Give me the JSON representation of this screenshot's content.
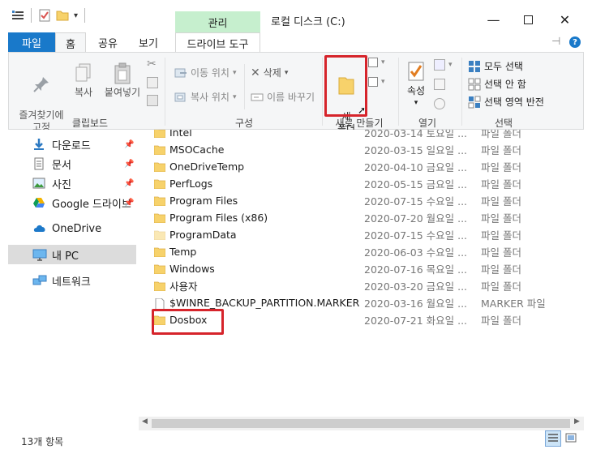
{
  "window": {
    "title": "로컬 디스크 (C:)",
    "context_tab": "관리"
  },
  "tabs": {
    "file": "파일",
    "home": "홈",
    "share": "공유",
    "view": "보기",
    "drive_tools": "드라이브 도구"
  },
  "ribbon": {
    "pin": "즐겨찾기에\n고정",
    "copy": "복사",
    "paste": "붙여넣기",
    "clipboard_group": "클립보드",
    "move_to": "이동 위치",
    "copy_to": "복사 위치",
    "delete": "삭제",
    "rename": "이름 바꾸기",
    "organize_group": "구성",
    "new_folder": "새\n폴더",
    "new_group": "새로 만들기",
    "properties": "속성",
    "open_group": "열기",
    "select_all": "모두 선택",
    "select_none": "선택 안 함",
    "invert_selection": "선택 영역 반전",
    "select_group": "선택"
  },
  "nav": [
    {
      "label": "다운로드",
      "icon": "download-icon",
      "pinned": true,
      "selected": false
    },
    {
      "label": "문서",
      "icon": "documents-icon",
      "pinned": true,
      "selected": false
    },
    {
      "label": "사진",
      "icon": "pictures-icon",
      "pinned": true,
      "selected": false
    },
    {
      "label": "Google 드라이브",
      "icon": "google-drive-icon",
      "pinned": true,
      "selected": false
    },
    {
      "label": "OneDrive",
      "icon": "onedrive-icon",
      "pinned": false,
      "selected": false
    },
    {
      "label": "내 PC",
      "icon": "this-pc-icon",
      "pinned": false,
      "selected": true
    },
    {
      "label": "네트워크",
      "icon": "network-icon",
      "pinned": false,
      "selected": false
    }
  ],
  "files": [
    {
      "name": "Intel",
      "date": "2020-03-14 토요일 ...",
      "type": "파일 폴더",
      "kind": "folder"
    },
    {
      "name": "MSOCache",
      "date": "2020-03-15 일요일 ...",
      "type": "파일 폴더",
      "kind": "folder"
    },
    {
      "name": "OneDriveTemp",
      "date": "2020-04-10 금요일 ...",
      "type": "파일 폴더",
      "kind": "folder"
    },
    {
      "name": "PerfLogs",
      "date": "2020-05-15 금요일 ...",
      "type": "파일 폴더",
      "kind": "folder"
    },
    {
      "name": "Program Files",
      "date": "2020-07-15 수요일 ...",
      "type": "파일 폴더",
      "kind": "folder"
    },
    {
      "name": "Program Files (x86)",
      "date": "2020-07-20 월요일 ...",
      "type": "파일 폴더",
      "kind": "folder"
    },
    {
      "name": "ProgramData",
      "date": "2020-07-15 수요일 ...",
      "type": "파일 폴더",
      "kind": "folder-faded"
    },
    {
      "name": "Temp",
      "date": "2020-06-03 수요일 ...",
      "type": "파일 폴더",
      "kind": "folder"
    },
    {
      "name": "Windows",
      "date": "2020-07-16 목요일 ...",
      "type": "파일 폴더",
      "kind": "folder"
    },
    {
      "name": "사용자",
      "date": "2020-03-20 금요일 ...",
      "type": "파일 폴더",
      "kind": "folder"
    },
    {
      "name": "$WINRE_BACKUP_PARTITION.MARKER",
      "date": "2020-03-16 월요일 ...",
      "type": "MARKER 파일",
      "kind": "file"
    },
    {
      "name": "Dosbox",
      "date": "2020-07-21 화요일 ...",
      "type": "파일 폴더",
      "kind": "folder"
    }
  ],
  "status": {
    "count": "13개 항목"
  },
  "colors": {
    "file_tab": "#1979ca",
    "manage_tab": "#c6efce",
    "highlight": "#d6242b",
    "folder": "#f7d26b"
  }
}
